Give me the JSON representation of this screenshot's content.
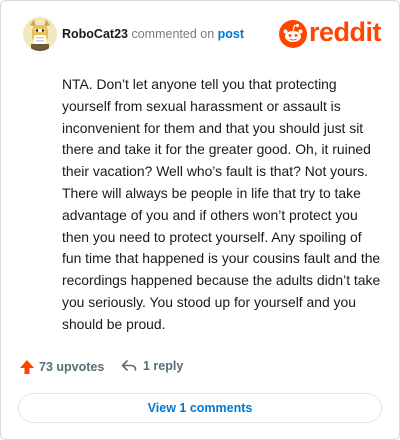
{
  "comment": {
    "username": "RoboCat23",
    "action": "commented on",
    "target": "post",
    "body": "NTA. Don’t let anyone tell you that protecting yourself from sexual harassment or assault is inconvenient for them and that you should just sit there and take it for the greater good. Oh, it ruined their vacation? Well who’s fault is that? Not yours. There will always be people in life that try to take advantage of you and if others won’t protect you then you need to protect yourself. Any spoiling of fun time that happened is your cousins fault and the recordings happened because the adults didn’t take you seriously. You stood up for yourself and you should be proud.",
    "upvotes": "73 upvotes",
    "replies": "1 reply"
  },
  "brand": {
    "wordmark": "reddit",
    "color": "#ff4500"
  },
  "footer": {
    "view_comments_label": "View 1 comments"
  },
  "colors": {
    "link": "#0079d3",
    "upvote": "#ff4500",
    "muted": "#576f76"
  },
  "icons": {
    "avatar": "avatar",
    "upvote": "upvote-arrow-icon",
    "reply": "reply-icon",
    "brand": "reddit-snoo-icon"
  }
}
